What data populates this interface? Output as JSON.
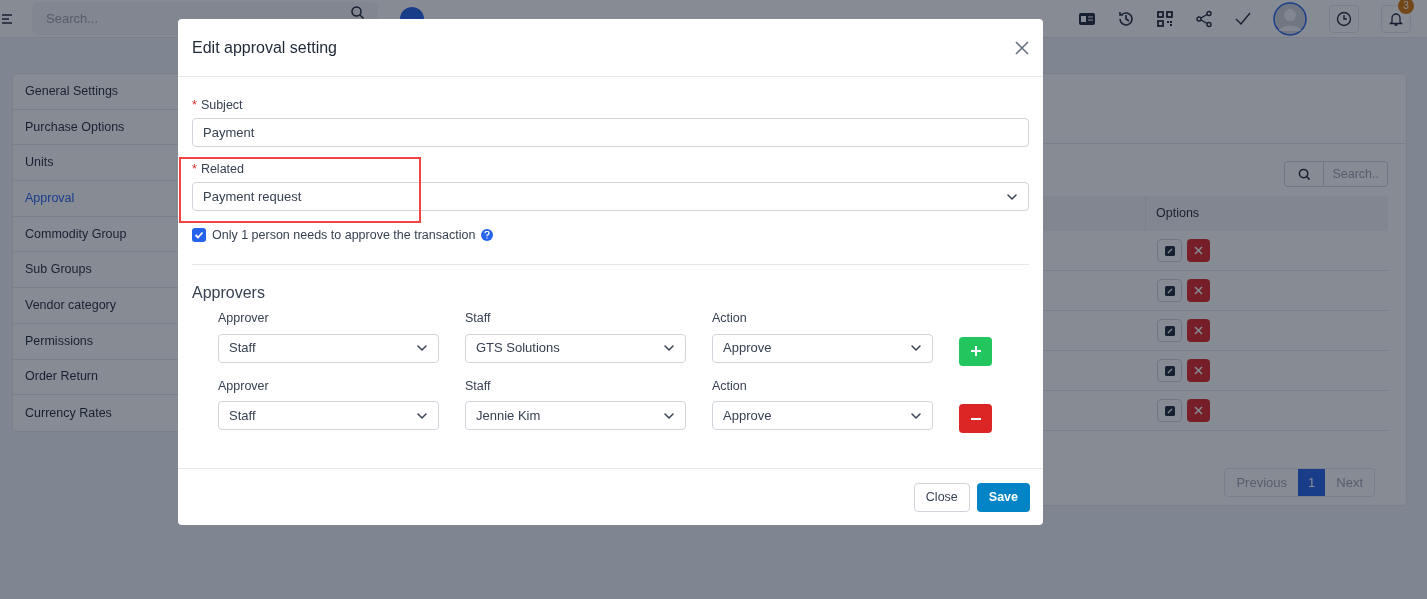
{
  "topbar": {
    "search_placeholder": "Search...",
    "notification_count": "3"
  },
  "sidebar": {
    "items": [
      {
        "label": "General Settings",
        "selected": false
      },
      {
        "label": "Purchase Options",
        "selected": false
      },
      {
        "label": "Units",
        "selected": false
      },
      {
        "label": "Approval",
        "selected": true
      },
      {
        "label": "Commodity Group",
        "selected": false
      },
      {
        "label": "Sub Groups",
        "selected": false
      },
      {
        "label": "Vendor category",
        "selected": false
      },
      {
        "label": "Permissions",
        "selected": false
      },
      {
        "label": "Order Return",
        "selected": false
      },
      {
        "label": "Currency Rates",
        "selected": false
      }
    ]
  },
  "table": {
    "search_placeholder": "Search..",
    "columns": [
      "Options"
    ]
  },
  "pagination": {
    "previous": "Previous",
    "pages": [
      {
        "label": "1",
        "selected": true
      }
    ],
    "next": "Next"
  },
  "modal": {
    "title": "Edit approval setting",
    "subject": {
      "label": "Subject",
      "required_mark": "*",
      "value": "Payment"
    },
    "related": {
      "label": "Related",
      "required_mark": "*",
      "value": "Payment request",
      "highlighted": true
    },
    "single_approver": {
      "label": "Only 1 person needs to approve the transaction",
      "checked": true
    },
    "approvers_heading": "Approvers",
    "approvers": [
      {
        "approver_label": "Approver",
        "approver": "Staff",
        "staff_label": "Staff",
        "staff": "GTS Solutions",
        "action_label": "Action",
        "action": "Approve",
        "kind": "add"
      },
      {
        "approver_label": "Approver",
        "approver": "Staff",
        "staff_label": "Staff",
        "staff": "Jennie Kim",
        "action_label": "Action",
        "action": "Approve",
        "kind": "remove"
      }
    ],
    "buttons": {
      "close": "Close",
      "save": "Save"
    }
  }
}
